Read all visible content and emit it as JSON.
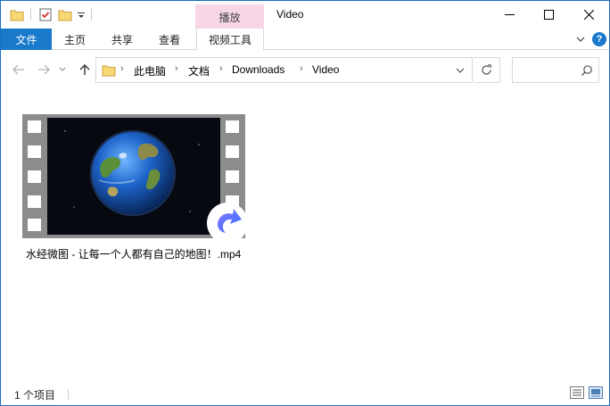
{
  "window": {
    "title": "Video",
    "context_tab": "播放"
  },
  "ribbon": {
    "tabs": [
      "文件",
      "主页",
      "共享",
      "查看",
      "视频工具"
    ],
    "help_label": "?"
  },
  "address": {
    "crumbs": [
      "此电脑",
      "文档",
      "Downloads",
      "Video"
    ],
    "separator": "›"
  },
  "search": {
    "placeholder": ""
  },
  "content": {
    "items": [
      {
        "name": "水经微图 - 让每一个人都有自己的地图！.mp4",
        "type": "video",
        "icon": "video-thumbnail-earth"
      }
    ]
  },
  "status": {
    "item_count": "1 个项目"
  },
  "colors": {
    "accent": "#1979ca",
    "context_tab": "#f7d7e6",
    "filmstrip": "#8c8c8c"
  }
}
